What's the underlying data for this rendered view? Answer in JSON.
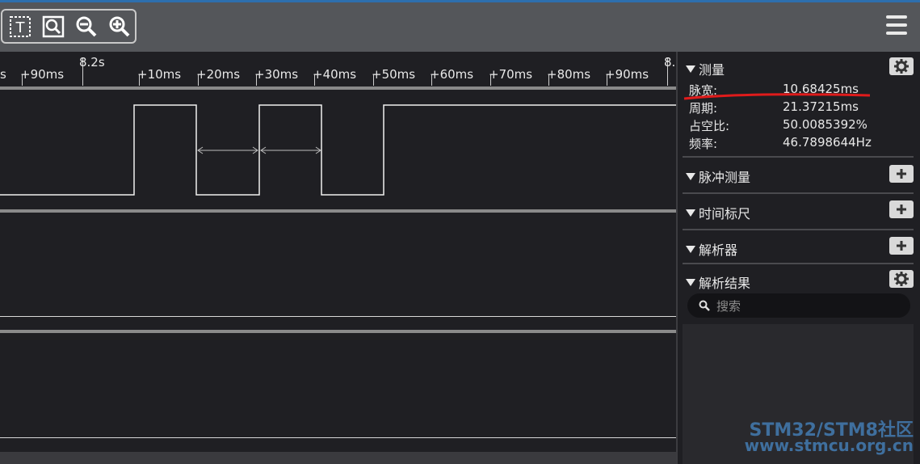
{
  "toolbar": {
    "tools": [
      {
        "icon": "text-cursor-icon"
      },
      {
        "icon": "zoom-fit-icon"
      },
      {
        "icon": "zoom-out-icon"
      },
      {
        "icon": "zoom-in-icon"
      }
    ],
    "menu_icon": "hamburger-menu-icon"
  },
  "ruler": {
    "labels": [
      "s",
      "+90ms",
      "8.2s",
      "+10ms",
      "+20ms",
      "+30ms",
      "+40ms",
      "+50ms",
      "+60ms",
      "+70ms",
      "+80ms",
      "+90ms",
      "8."
    ]
  },
  "panel": {
    "measure": {
      "title": "测量",
      "rows": [
        {
          "label": "脉宽:",
          "value": "10.68425ms"
        },
        {
          "label": "周期:",
          "value": "21.37215ms"
        },
        {
          "label": "占空比:",
          "value": "50.0085392%"
        },
        {
          "label": "频率:",
          "value": "46.7898644Hz"
        }
      ]
    },
    "pulse": {
      "title": "脉冲测量"
    },
    "timing": {
      "title": "时间标尺"
    },
    "analyzer": {
      "title": "解析器"
    },
    "results": {
      "title": "解析结果",
      "search_placeholder": "搜索"
    }
  },
  "watermark": {
    "line1": "STM32/STM8社区",
    "line2": "www.stmcu.org.cn"
  },
  "colors": {
    "accent": "#2d6fae",
    "annotation": "#e01b1b",
    "watermark": "#3f6f9e"
  }
}
